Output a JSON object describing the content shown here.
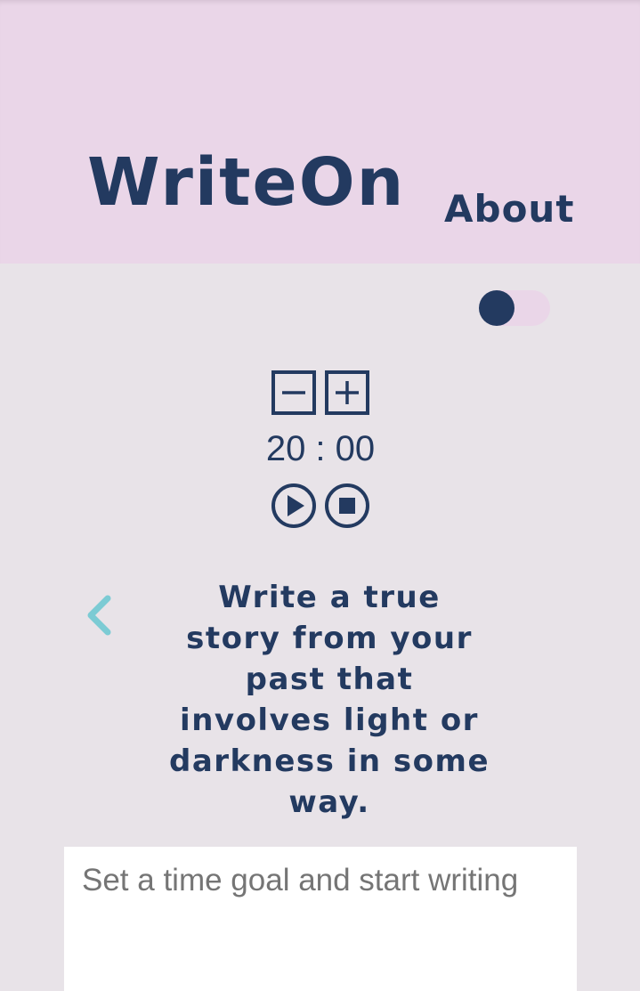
{
  "header": {
    "logo": "WriteOn",
    "nav_about": "About"
  },
  "theme_toggle": {
    "state": "off"
  },
  "timer": {
    "minutes": "20",
    "separator": ":",
    "seconds": "00",
    "display": "20 : 00"
  },
  "controls": {
    "decrease_icon": "minus-square-icon",
    "increase_icon": "plus-square-icon",
    "play_icon": "play-circle-icon",
    "stop_icon": "stop-circle-icon"
  },
  "prompt": {
    "text": "Write a true story from your past that involves light or darkness in some way.",
    "previous_icon": "chevron-left-icon"
  },
  "editor": {
    "value": "",
    "placeholder": "Set a time goal and start writing"
  },
  "colors": {
    "primary": "#233a60",
    "header_bg": "#ead6e8",
    "page_bg": "#e8e3e8",
    "accent": "#7ccbd4"
  }
}
